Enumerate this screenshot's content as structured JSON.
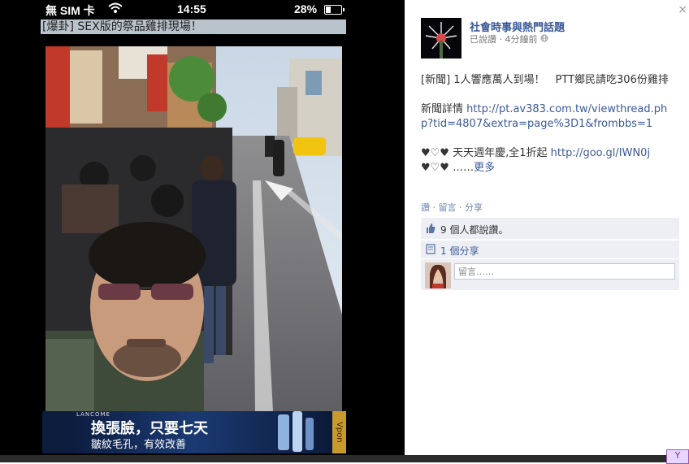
{
  "phone_status": {
    "carrier": "無 SIM 卡",
    "time": "14:55",
    "battery": "28%"
  },
  "caption": "[爆卦] SEX版的祭品雞排現場！",
  "ad": {
    "brand": "LANCÔME",
    "headline": "換張臉，只要七天",
    "subline": "皺紋毛孔，有效改善",
    "logo": "Vpon"
  },
  "post": {
    "page_name": "社會時事與熱門話題",
    "meta": "已說讚 · 4分鐘前",
    "paragraphs": [
      {
        "text": "[新聞] 1人響應萬人到場！　PTT鄉民請吃306份雞排",
        "link": ""
      },
      {
        "text": "新聞詳情 ",
        "link": "http://pt.av383.com.tw/viewthread.php?tid=4807&extra=page%3D1&frombbs=1"
      },
      {
        "text": "♥♡♥ 天天週年慶,全1折起 ",
        "link": "http://goo.gl/IWN0j",
        "suffix": " ♥♡♥ ……",
        "more": "更多"
      }
    ],
    "actions": "讚 · 留言 · 分享",
    "likes": "9 個人都說讚。",
    "shares": "1 個分享",
    "comment_placeholder": "留言……"
  },
  "close_label": "×",
  "colors": {
    "link": "#3b5998",
    "panel_bg": "#edeff4",
    "viewer_bg": "#000000"
  },
  "icons": [
    "wifi-icon",
    "battery-icon",
    "globe-icon",
    "like-thumb-icon",
    "share-icon",
    "close-icon"
  ]
}
